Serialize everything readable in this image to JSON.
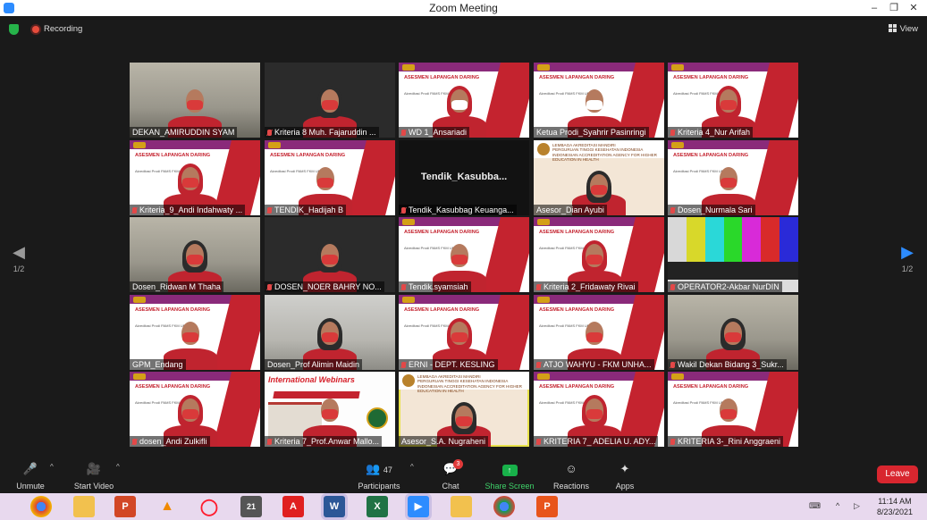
{
  "window": {
    "title": "Zoom Meeting"
  },
  "topbar": {
    "recording_label": "Recording",
    "view_label": "View"
  },
  "pager": {
    "left": "1/2",
    "right": "1/2"
  },
  "participants": [
    {
      "name": "DEKAN_AMIRUDDIN SYAM",
      "bg": "room",
      "muted": false
    },
    {
      "name": "Kriteria 8 Muh. Fajaruddin ...",
      "bg": "dark",
      "muted": true
    },
    {
      "name": "WD 1_Ansariadi",
      "bg": "slide",
      "muted": true
    },
    {
      "name": "Ketua Prodi_Syahrir Pasinringi",
      "bg": "slide",
      "muted": false
    },
    {
      "name": "Kriteria 4_Nur Arifah",
      "bg": "slide",
      "muted": true
    },
    {
      "name": "Kriteria_9_Andi  Indahwaty ...",
      "bg": "slide",
      "muted": true
    },
    {
      "name": "TENDIK_Hadijah B",
      "bg": "slide",
      "muted": true
    },
    {
      "name": "Tendik_Kasubbag Keuanga...",
      "bg": "black",
      "muted": true,
      "center_name": "Tendik_Kasubba..."
    },
    {
      "name": "Asesor_Dian Ayubi",
      "bg": "lembaga",
      "muted": false
    },
    {
      "name": "Dosen_Nurmala Sari",
      "bg": "slide",
      "muted": true
    },
    {
      "name": "Dosen_Ridwan M Thaha",
      "bg": "room",
      "muted": false
    },
    {
      "name": "DOSEN_NOER BAHRY NO...",
      "bg": "dark",
      "muted": true
    },
    {
      "name": "Tendik.syamsiah",
      "bg": "slide",
      "muted": true
    },
    {
      "name": "Kriteria 2_Fridawaty Rivai",
      "bg": "slide",
      "muted": true
    },
    {
      "name": "OPERATOR2-Akbar NurDIN",
      "bg": "bars",
      "muted": true
    },
    {
      "name": "GPM_Endang",
      "bg": "slide",
      "muted": false
    },
    {
      "name": "Dosen_Prof Alimin Maidin",
      "bg": "room2",
      "muted": false
    },
    {
      "name": "ERNI - DEPT. KESLING",
      "bg": "slide",
      "muted": true
    },
    {
      "name": "ATJO WAHYU - FKM UNHA...",
      "bg": "slide",
      "muted": true
    },
    {
      "name": "Wakil Dekan Bidang 3_Sukr...",
      "bg": "room",
      "muted": true
    },
    {
      "name": "dosen_Andi Zulkifli",
      "bg": "slide",
      "muted": true
    },
    {
      "name": "Kriteria 7_Prof.Anwar Mallo...",
      "bg": "web",
      "muted": true
    },
    {
      "name": "Asesor_S.A. Nugraheni",
      "bg": "lembaga",
      "muted": false,
      "active": true
    },
    {
      "name": "KRITERIA 7_ ADELIA U. ADY...",
      "bg": "slide",
      "muted": true
    },
    {
      "name": "KRITERIA 3-_Rini Anggraeni",
      "bg": "slide",
      "muted": true
    }
  ],
  "slide_text": {
    "title": "ASESMEN LAPANGAN DARING",
    "sub": "Akreditasi Prodi PAMS FKM UNHAS"
  },
  "lembaga_text": {
    "line1": "LEMBAGA AKREDITASI MANDIRI",
    "line2": "PERGURUAN TINGGI KESEHATAN INDONESIA",
    "line3": "INDONESIAN ACCREDITATION AGENCY FOR HIGHER EDUCATION IN HEALTH"
  },
  "web_text": {
    "title": "International Webinars",
    "banner": "Environmental Health Emerging Disease"
  },
  "toolbar": {
    "unmute": "Unmute",
    "start_video": "Start Video",
    "participants": "Participants",
    "participants_count": "47",
    "chat": "Chat",
    "chat_badge": "3",
    "share": "Share Screen",
    "reactions": "Reactions",
    "apps": "Apps",
    "leave": "Leave"
  },
  "taskbar": {
    "apps": [
      "chrome",
      "explorer",
      "powerpoint",
      "vlc",
      "opera",
      "calendar",
      "acrobat",
      "word",
      "excel",
      "zoom",
      "files",
      "chrome2",
      "app"
    ],
    "time": "11:14 AM",
    "date": "8/23/2021"
  },
  "colors": {
    "accent_red": "#c4232f",
    "share_green": "#18b14a",
    "leave_red": "#d8262f",
    "active_outline": "#e8e24a"
  }
}
